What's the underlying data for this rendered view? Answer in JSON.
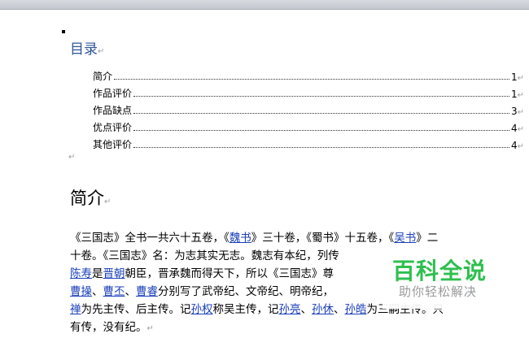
{
  "toc": {
    "title": "目录",
    "items": [
      {
        "label": "简介",
        "page": "1"
      },
      {
        "label": "作品评价",
        "page": "1"
      },
      {
        "label": "作品缺点",
        "page": "3"
      },
      {
        "label": "优点评价",
        "page": "4"
      },
      {
        "label": "其他评价",
        "page": "4"
      }
    ]
  },
  "section": {
    "heading": "简介"
  },
  "paragraph": {
    "line1": {
      "a": "《三国志》全书一共六十五卷，《",
      "l1": "魏书",
      "b": "》三十卷，《蜀书》十五卷，《",
      "l2": "吴书",
      "c": "》二"
    },
    "line2": {
      "a": "十卷。《三国志》名：为志其实无志。魏志有本纪，列传",
      "b": "，"
    },
    "line3": {
      "l1": "陈寿",
      "a": "是",
      "l2": "晋朝",
      "b": "朝臣，晋承魏而得天下，所以《三国志》尊",
      "c": "为"
    },
    "line4": {
      "l1": "曹操",
      "a": "、",
      "l2": "曹丕",
      "b": "、",
      "l3": "曹睿",
      "c": "分别写了武帝纪、文帝纪、明帝纪，",
      "l4": "刘"
    },
    "line5": {
      "l1": "禅",
      "a": "为先主传、后主传。记",
      "l2": "孙权",
      "b": "称吴主传，记",
      "l3": "孙亮",
      "c": "、",
      "l4": "孙休",
      "d": "、",
      "l5": "孙皓",
      "e": "为三嗣主传。只"
    },
    "line6": {
      "a": "有传，没有纪。"
    }
  },
  "watermark": {
    "title": "百科全说",
    "subtitle": "助你轻松解决"
  },
  "para_mark": "↵"
}
